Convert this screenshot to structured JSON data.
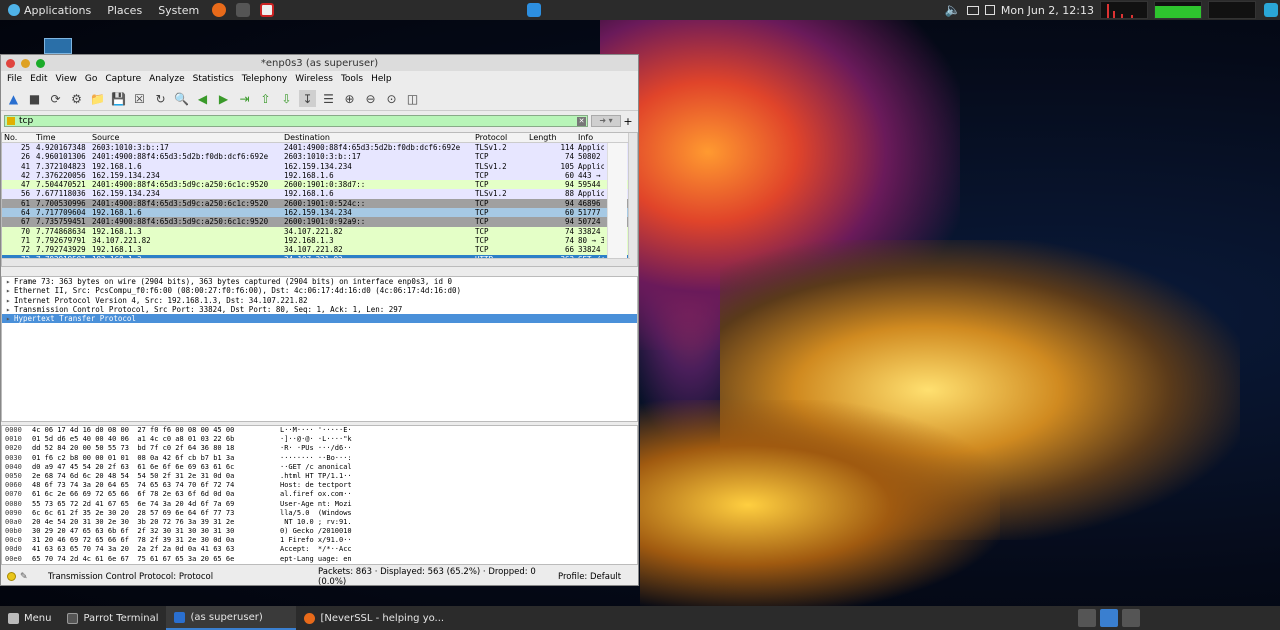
{
  "top_panel": {
    "menus": [
      "Applications",
      "Places",
      "System"
    ],
    "clock": "Mon Jun 2, 12:13"
  },
  "window": {
    "title": "*enp0s3 (as superuser)",
    "menubar": [
      "File",
      "Edit",
      "View",
      "Go",
      "Capture",
      "Analyze",
      "Statistics",
      "Telephony",
      "Wireless",
      "Tools",
      "Help"
    ],
    "filter": "tcp",
    "columns": [
      "No.",
      "Time",
      "Source",
      "Destination",
      "Protocol",
      "Length",
      "Info"
    ],
    "packets": [
      {
        "no": "25",
        "time": "4.920167348",
        "src": "2603:1010:3:b::17",
        "dst": "2401:4900:88f4:65d3:5d2b:f0db:dcf6:692e",
        "proto": "TLSv1.2",
        "len": "114",
        "info": "Applic",
        "bg": "#e7e6ff"
      },
      {
        "no": "26",
        "time": "4.960101306",
        "src": "2401:4900:88f4:65d3:5d2b:f0db:dcf6:692e",
        "dst": "2603:1010:3:b::17",
        "proto": "TCP",
        "len": "74",
        "info": "50802",
        "bg": "#e7e6ff"
      },
      {
        "no": "41",
        "time": "7.372104823",
        "src": "192.168.1.6",
        "dst": "162.159.134.234",
        "proto": "TLSv1.2",
        "len": "105",
        "info": "Applic",
        "bg": "#e7e6ff"
      },
      {
        "no": "42",
        "time": "7.376220056",
        "src": "162.159.134.234",
        "dst": "192.168.1.6",
        "proto": "TCP",
        "len": "60",
        "info": "443 →",
        "bg": "#e7e6ff"
      },
      {
        "no": "47",
        "time": "7.504470521",
        "src": "2401:4900:88f4:65d3:5d9c:a250:6c1c:9520",
        "dst": "2600:1901:0:38d7::",
        "proto": "TCP",
        "len": "94",
        "info": "59544",
        "bg": "#e4ffc7"
      },
      {
        "no": "56",
        "time": "7.677118036",
        "src": "162.159.134.234",
        "dst": "192.168.1.6",
        "proto": "TLSv1.2",
        "len": "88",
        "info": "Applic",
        "bg": "#e7e6ff"
      },
      {
        "no": "61",
        "time": "7.700530996",
        "src": "2401:4900:88f4:65d3:5d9c:a250:6c1c:9520",
        "dst": "2600:1901:0:524c::",
        "proto": "TCP",
        "len": "94",
        "info": "46896",
        "bg": "#a0a0a0"
      },
      {
        "no": "64",
        "time": "7.717709604",
        "src": "192.168.1.6",
        "dst": "162.159.134.234",
        "proto": "TCP",
        "len": "60",
        "info": "51777",
        "bg": "#a6c9e4"
      },
      {
        "no": "67",
        "time": "7.735759451",
        "src": "2401:4900:88f4:65d3:5d9c:a250:6c1c:9520",
        "dst": "2600:1901:0:92a9::",
        "proto": "TCP",
        "len": "94",
        "info": "50724",
        "bg": "#a0a0a0"
      },
      {
        "no": "70",
        "time": "7.774868634",
        "src": "192.168.1.3",
        "dst": "34.107.221.82",
        "proto": "TCP",
        "len": "74",
        "info": "33824",
        "bg": "#e4ffc7"
      },
      {
        "no": "71",
        "time": "7.792679791",
        "src": "34.107.221.82",
        "dst": "192.168.1.3",
        "proto": "TCP",
        "len": "74",
        "info": "80 → 3",
        "bg": "#e4ffc7"
      },
      {
        "no": "72",
        "time": "7.792743929",
        "src": "192.168.1.3",
        "dst": "34.107.221.82",
        "proto": "TCP",
        "len": "66",
        "info": "33824",
        "bg": "#e4ffc7"
      },
      {
        "no": "73",
        "time": "7.792919507",
        "src": "192.168.1.3",
        "dst": "34.107.221.82",
        "proto": "HTTP",
        "len": "363",
        "info": "GET /c",
        "bg": "#2c7fc7",
        "fg": "#ffffff"
      }
    ],
    "details": [
      "Frame 73: 363 bytes on wire (2904 bits), 363 bytes captured (2904 bits) on interface enp0s3, id 0",
      "Ethernet II, Src: PcsCompu_f0:f6:00 (08:00:27:f0:f6:00), Dst: 4c:06:17:4d:16:d0 (4c:06:17:4d:16:d0)",
      "Internet Protocol Version 4, Src: 192.168.1.3, Dst: 34.107.221.82",
      "Transmission Control Protocol, Src Port: 33824, Dst Port: 80, Seq: 1, Ack: 1, Len: 297",
      "Hypertext Transfer Protocol"
    ],
    "selected_detail": 4,
    "bytes": [
      {
        "off": "0000",
        "hex": "4c 06 17 4d 16 d0 08 00  27 f0 f6 00 08 00 45 00",
        "asc": "L··M···· '·····E·"
      },
      {
        "off": "0010",
        "hex": "01 5d d6 e5 40 00 40 06  a1 4c c0 a8 01 03 22 6b",
        "asc": "·]··@·@· ·L····\"k"
      },
      {
        "off": "0020",
        "hex": "dd 52 84 20 00 50 55 73  bd 7f c0 2f 64 36 80 18",
        "asc": "·R· ·PUs ···/d6··"
      },
      {
        "off": "0030",
        "hex": "01 f6 c2 b8 00 00 01 01  08 0a 42 6f cb b7 b1 3a",
        "asc": "········ ··Bo···:"
      },
      {
        "off": "0040",
        "hex": "d0 a9 47 45 54 20 2f 63  61 6e 6f 6e 69 63 61 6c",
        "asc": "··GET /c anonical"
      },
      {
        "off": "0050",
        "hex": "2e 68 74 6d 6c 20 48 54  54 50 2f 31 2e 31 0d 0a",
        ".hex": "",
        "asc": ".html HT TP/1.1··"
      },
      {
        "off": "0060",
        "hex": "48 6f 73 74 3a 20 64 65  74 65 63 74 70 6f 72 74",
        "asc": "Host: de tectport"
      },
      {
        "off": "0070",
        "hex": "61 6c 2e 66 69 72 65 66  6f 78 2e 63 6f 6d 0d 0a",
        "asc": "al.firef ox.com··"
      },
      {
        "off": "0080",
        "hex": "55 73 65 72 2d 41 67 65  6e 74 3a 20 4d 6f 7a 69",
        "asc": "User-Age nt: Mozi"
      },
      {
        "off": "0090",
        "hex": "6c 6c 61 2f 35 2e 30 20  28 57 69 6e 64 6f 77 73",
        "asc": "lla/5.0  (Windows"
      },
      {
        "off": "00a0",
        "hex": "20 4e 54 20 31 30 2e 30  3b 20 72 76 3a 39 31 2e",
        "asc": " NT 10.0 ; rv:91."
      },
      {
        "off": "00b0",
        "hex": "30 29 20 47 65 63 6b 6f  2f 32 30 31 30 30 31 30",
        "asc": "0) Gecko /2010010"
      },
      {
        "off": "00c0",
        "hex": "31 20 46 69 72 65 66 6f  78 2f 39 31 2e 30 0d 0a",
        "asc": "1 Firefo x/91.0··"
      },
      {
        "off": "00d0",
        "hex": "41 63 63 65 70 74 3a 20  2a 2f 2a 0d 0a 41 63 63",
        "asc": "Accept:  */*··Acc"
      },
      {
        "off": "00e0",
        "hex": "65 70 74 2d 4c 61 6e 67  75 61 67 65 3a 20 65 6e",
        "asc": "ept-Lang uage: en"
      }
    ],
    "status": {
      "field": "Transmission Control Protocol: Protocol",
      "packets": "Packets: 863 · Displayed: 563 (65.2%) · Dropped: 0 (0.0%)",
      "profile": "Profile: Default"
    }
  },
  "taskbar": {
    "menu": "Menu",
    "items": [
      {
        "label": "Parrot Terminal",
        "active": false
      },
      {
        "label": "(as superuser)",
        "active": true
      },
      {
        "label": "[NeverSSL - helping yo...",
        "active": false
      }
    ]
  }
}
